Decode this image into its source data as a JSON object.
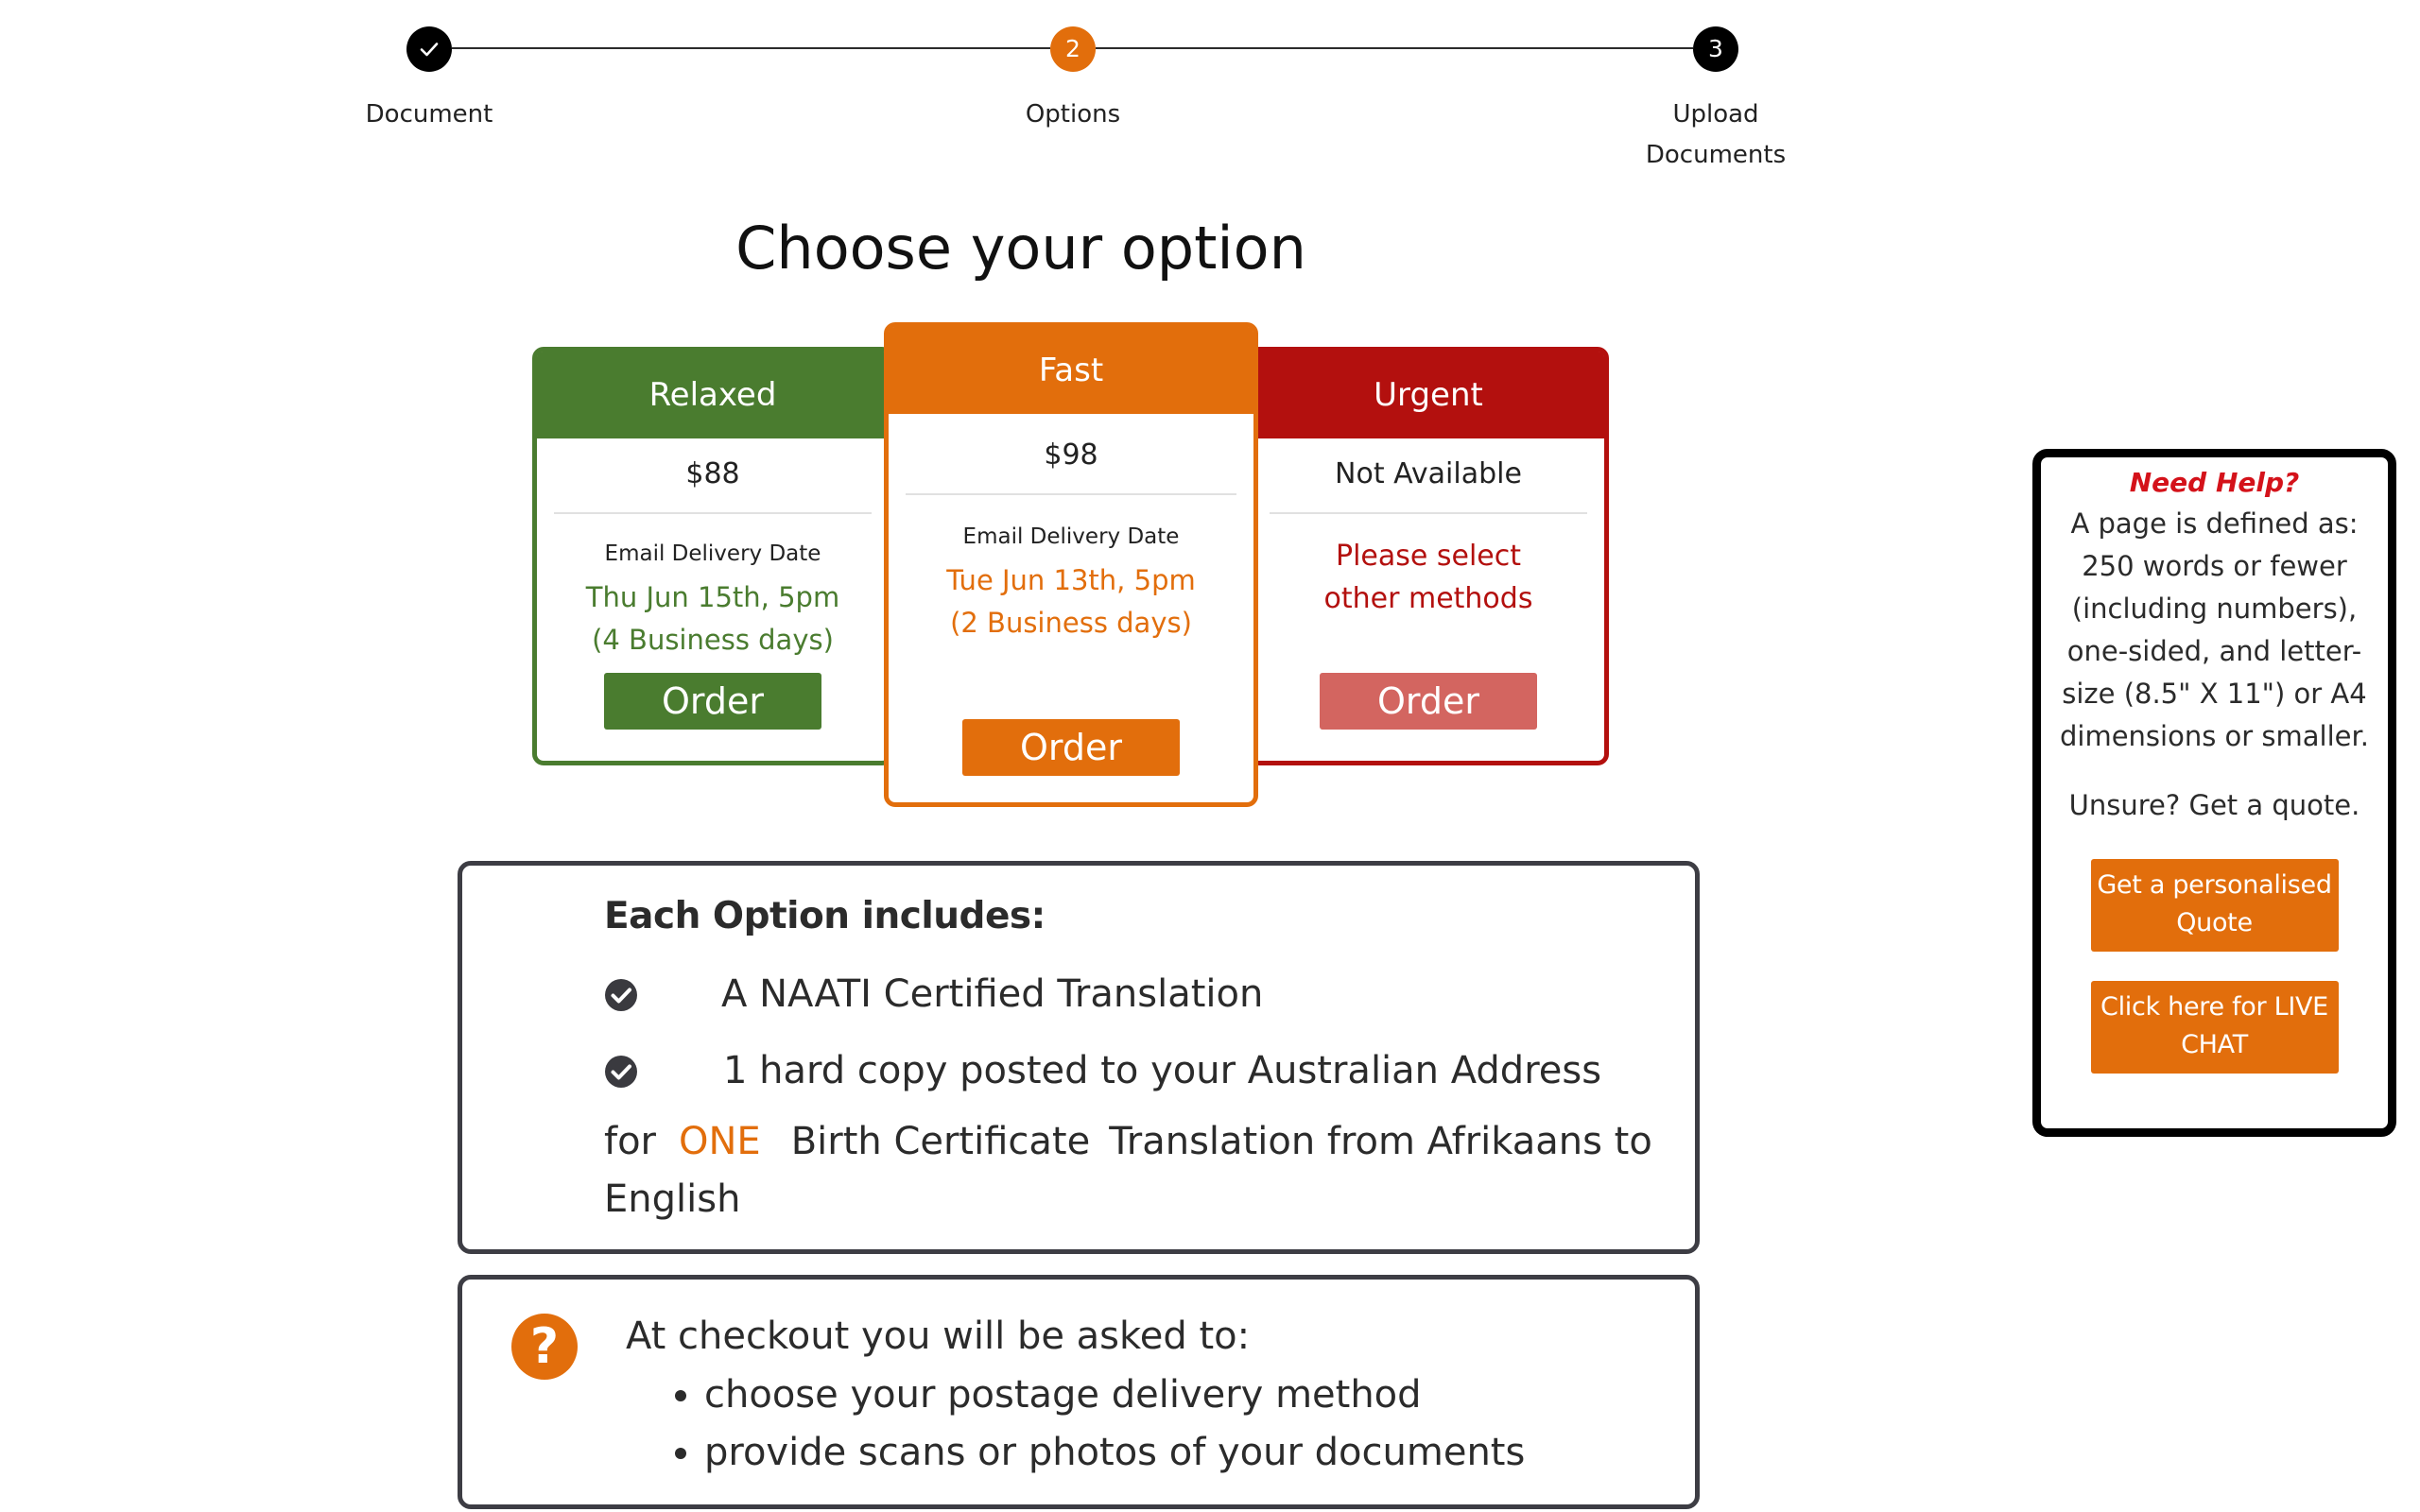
{
  "stepper": {
    "steps": [
      {
        "number": "",
        "label": "Document",
        "state": "complete",
        "icon": "checkmark-icon"
      },
      {
        "number": "2",
        "label": "Options",
        "state": "current"
      },
      {
        "number": "3",
        "label": "Upload Documents",
        "state": "upcoming"
      }
    ],
    "colors": {
      "complete": "#000000",
      "current": "#e26e0c",
      "upcoming": "#000000"
    }
  },
  "page_title": "Choose your option",
  "plans": {
    "relaxed": {
      "name": "Relaxed",
      "price": "$88",
      "delivery_label": "Email Delivery Date",
      "delivery_date": "Thu Jun 15th, 5pm",
      "business_days": "(4 Business days)",
      "order_label": "Order",
      "color": "#4a7c2f"
    },
    "fast": {
      "name": "Fast",
      "price": "$98",
      "delivery_label": "Email Delivery Date",
      "delivery_date": "Tue Jun 13th, 5pm",
      "business_days": "(2 Business days)",
      "order_label": "Order",
      "color": "#e26e0c"
    },
    "urgent": {
      "name": "Urgent",
      "price": "Not Available",
      "message": "Please select other methods",
      "order_label": "Order",
      "color": "#b3100e",
      "button_color": "#d36560"
    }
  },
  "includes": {
    "title": "Each Option includes:",
    "items": [
      {
        "icon": "check-circle-icon",
        "text": "A NAATI Certified Translation"
      },
      {
        "icon": "check-circle-icon",
        "text": "1 hard copy posted to your Australian Address"
      }
    ],
    "for_label": "for",
    "count": "ONE",
    "document": "Birth Certificate",
    "translation": "Translation from Afrikaans to English"
  },
  "checkout": {
    "icon": "question-circle-icon",
    "icon_glyph": "?",
    "title": "At checkout you will be asked to:",
    "items": [
      "choose your postage delivery method",
      "provide scans or photos of your documents"
    ]
  },
  "help": {
    "title": "Need Help?",
    "text": "A page is defined as: 250 words or fewer (including numbers), one-sided, and letter-size (8.5\" X 11\") or A4 dimensions or smaller.",
    "unsure": "Unsure? Get a quote.",
    "quote_button": "Get a personalised Quote",
    "chat_button": "Click here for LIVE CHAT"
  }
}
